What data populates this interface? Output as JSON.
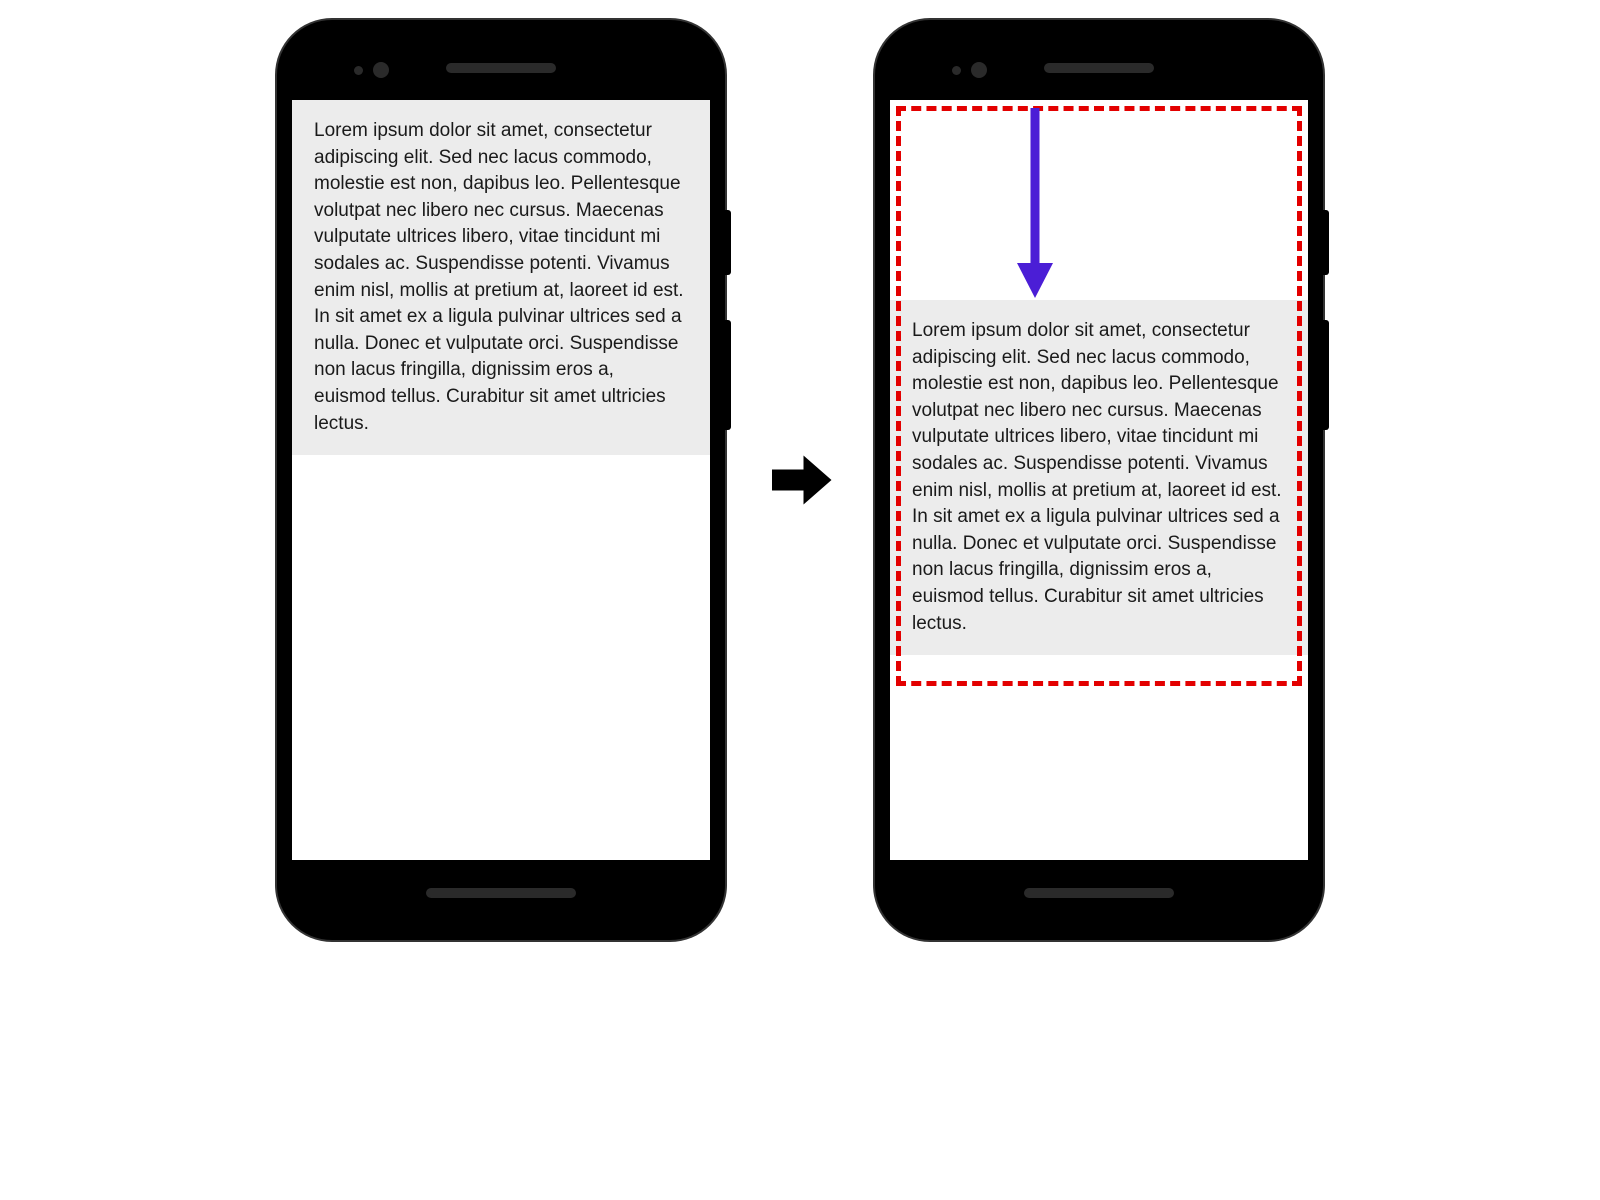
{
  "lorem_text": "Lorem ipsum dolor sit amet, consectetur adipiscing elit. Sed nec lacus commodo, molestie est non, dapibus leo. Pellentesque volutpat nec libero nec cursus. Maecenas vulputate ultrices libero, vitae tincidunt mi sodales ac. Suspendisse potenti. Vivamus enim nisl, mollis at pretium at, laoreet id est. In sit amet ex a ligula pulvinar ultrices sed a nulla. Donec et vulputate orci. Suspendisse non lacus fringilla, dignissim eros a, euismod tellus. Curabitur sit amet ultricies lectus.",
  "colors": {
    "dashed_border": "#e30000",
    "scroll_arrow": "#4b1ed6",
    "transition_arrow": "#000000",
    "text_block_bg": "#ececec"
  }
}
